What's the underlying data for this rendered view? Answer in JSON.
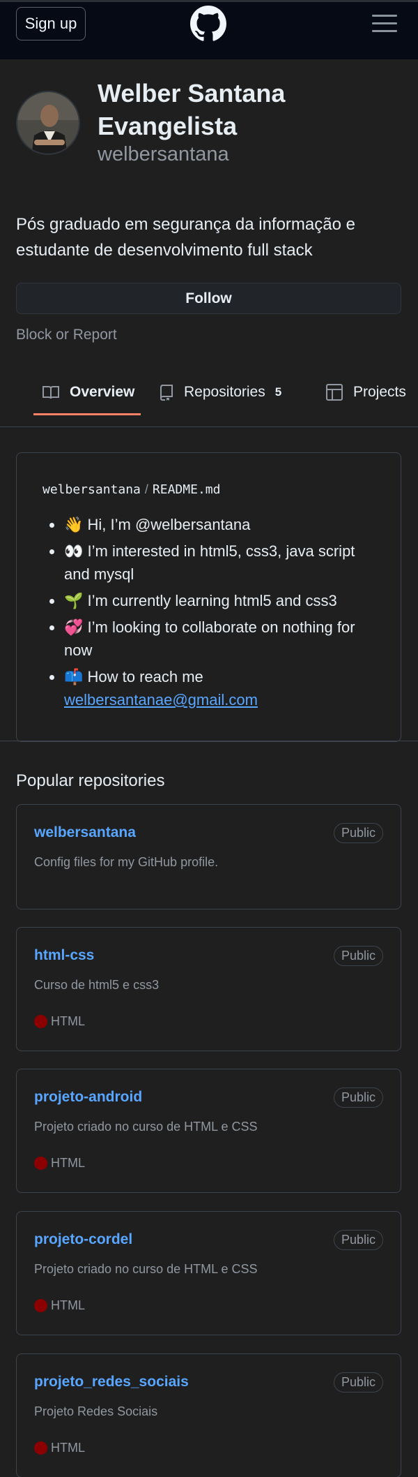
{
  "header": {
    "signup_label": "Sign up",
    "logo_icon": "github-mark-icon",
    "menu_icon": "hamburger-menu-icon"
  },
  "profile": {
    "name": "Welber Santana Evangelista",
    "username": "welbersantana",
    "bio": "Pós graduado em segurança da informação e estudante de desenvolvimento full stack",
    "follow_label": "Follow",
    "block_report_label": "Block or Report"
  },
  "tabs": [
    {
      "label": "Overview",
      "icon": "book-icon",
      "selected": true
    },
    {
      "label": "Repositories",
      "icon": "repo-icon",
      "count": "5"
    },
    {
      "label": "Projects",
      "icon": "table-icon"
    }
  ],
  "readme": {
    "user": "welbersantana",
    "separator": "/",
    "file": "README",
    "ext": ".md",
    "items": [
      "👋 Hi, I’m @welbersantana",
      "👀 I’m interested in html5, css3, java script and mysql",
      "🌱 I’m currently learning html5 and css3",
      "💞️ I’m looking to collaborate on nothing for now",
      "📫 How to reach me"
    ],
    "email": "welbersantanae@gmail.com"
  },
  "popular": {
    "title": "Popular repositories",
    "repos": [
      {
        "name": "welbersantana",
        "visibility": "Public",
        "description": "Config files for my GitHub profile.",
        "language": ""
      },
      {
        "name": "html-css",
        "visibility": "Public",
        "description": "Curso de html5 e css3",
        "language": "HTML"
      },
      {
        "name": "projeto-android",
        "visibility": "Public",
        "description": "Projeto criado no curso de HTML e CSS",
        "language": "HTML"
      },
      {
        "name": "projeto-cordel",
        "visibility": "Public",
        "description": "Projeto criado no curso de HTML e CSS",
        "language": "HTML"
      },
      {
        "name": "projeto_redes_sociais",
        "visibility": "Public",
        "description": "Projeto Redes Sociais",
        "language": "HTML"
      }
    ]
  },
  "colors": {
    "background": "#1f1f1f",
    "header_bg": "#050a14",
    "link": "#58a6ff",
    "tab_underline": "#f78166",
    "html_lang": "#8b0000"
  }
}
